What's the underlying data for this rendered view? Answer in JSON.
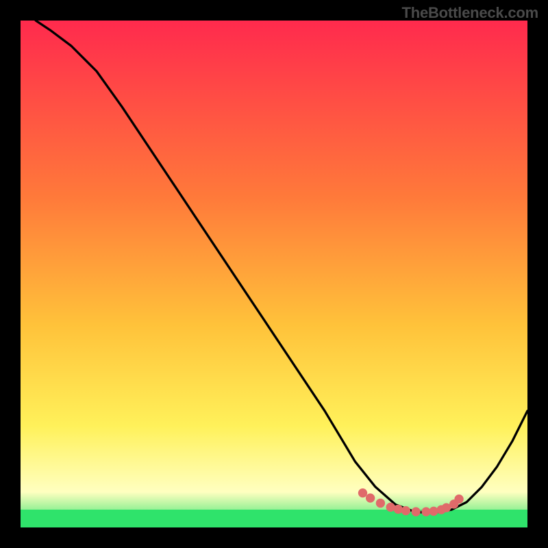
{
  "watermark": "TheBottleneck.com",
  "colors": {
    "frame": "#000000",
    "grad_top": "#ff2a4d",
    "grad_mid_upper": "#ff7a3a",
    "grad_mid": "#ffc23a",
    "grad_low": "#fff15a",
    "grad_pale": "#ffffc0",
    "accent_green": "#2fe36b",
    "curve": "#000000",
    "markers": "#e06a6a"
  },
  "chart_data": {
    "type": "line",
    "title": "",
    "xlabel": "",
    "ylabel": "",
    "xlim": [
      0,
      100
    ],
    "ylim": [
      0,
      100
    ],
    "series": [
      {
        "name": "curve",
        "x": [
          3,
          6,
          10,
          15,
          20,
          25,
          30,
          35,
          40,
          45,
          50,
          55,
          60,
          63,
          66,
          70,
          74,
          78,
          82,
          85,
          88,
          91,
          94,
          97,
          100
        ],
        "y": [
          100,
          98,
          95,
          90,
          83,
          75.5,
          68,
          60.5,
          53,
          45.5,
          38,
          30.5,
          23,
          18,
          13,
          8,
          4.5,
          3,
          3,
          3.5,
          5,
          8,
          12,
          17,
          23
        ]
      }
    ],
    "markers": {
      "name": "valley-markers",
      "x": [
        67.5,
        69,
        71,
        73,
        74.5,
        76,
        78,
        80,
        81.5,
        83,
        84,
        85.5,
        86.5
      ],
      "y": [
        6.8,
        5.8,
        4.8,
        4.0,
        3.6,
        3.3,
        3.1,
        3.1,
        3.2,
        3.5,
        3.9,
        4.6,
        5.6
      ]
    },
    "gradient_stops": [
      {
        "offset": 0,
        "key": "grad_top"
      },
      {
        "offset": 0.35,
        "key": "grad_mid_upper"
      },
      {
        "offset": 0.6,
        "key": "grad_mid"
      },
      {
        "offset": 0.8,
        "key": "grad_low"
      },
      {
        "offset": 0.93,
        "key": "grad_pale"
      },
      {
        "offset": 1.0,
        "key": "accent_green"
      }
    ],
    "accent_band": {
      "y_from": 0,
      "y_to": 3.5
    }
  }
}
